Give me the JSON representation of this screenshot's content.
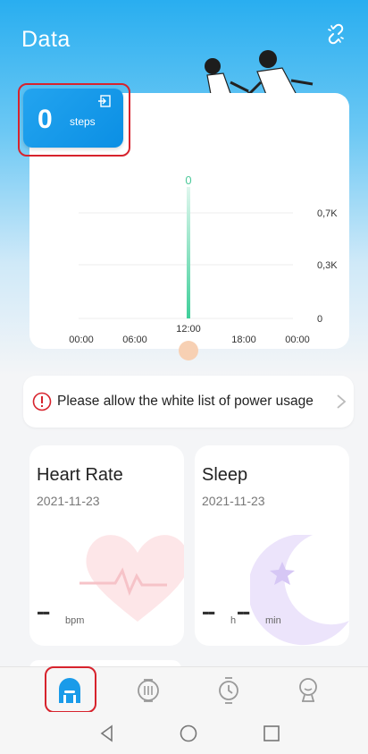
{
  "header": {
    "title": "Data"
  },
  "steps_card": {
    "value": "0",
    "unit": "steps"
  },
  "chart_data": {
    "type": "bar",
    "x_ticks": [
      "00:00",
      "06:00",
      "12:00",
      "18:00",
      "00:00"
    ],
    "y_ticks": [
      "0,7K",
      "0,3K",
      "0"
    ],
    "bars": [
      {
        "x": "12:00",
        "value": 0,
        "label": "0"
      }
    ]
  },
  "notice": {
    "text": "Please allow the white list of power usage"
  },
  "heart_rate": {
    "title": "Heart Rate",
    "date": "2021-11-23",
    "value": "--",
    "unit": "bpm"
  },
  "sleep": {
    "title": "Sleep",
    "date": "2021-11-23",
    "hours_value": "--",
    "hours_unit": "h",
    "minutes_value": "--",
    "minutes_unit": "min"
  },
  "tabs": [
    {
      "icon": "home-icon",
      "active": true
    },
    {
      "icon": "watch-face-icon",
      "active": false
    },
    {
      "icon": "watch-icon",
      "active": false
    },
    {
      "icon": "profile-icon",
      "active": false
    }
  ],
  "colors": {
    "accent": "#1a9be9",
    "highlight": "#d7232d",
    "chart_bar": "#3fcf9a"
  }
}
